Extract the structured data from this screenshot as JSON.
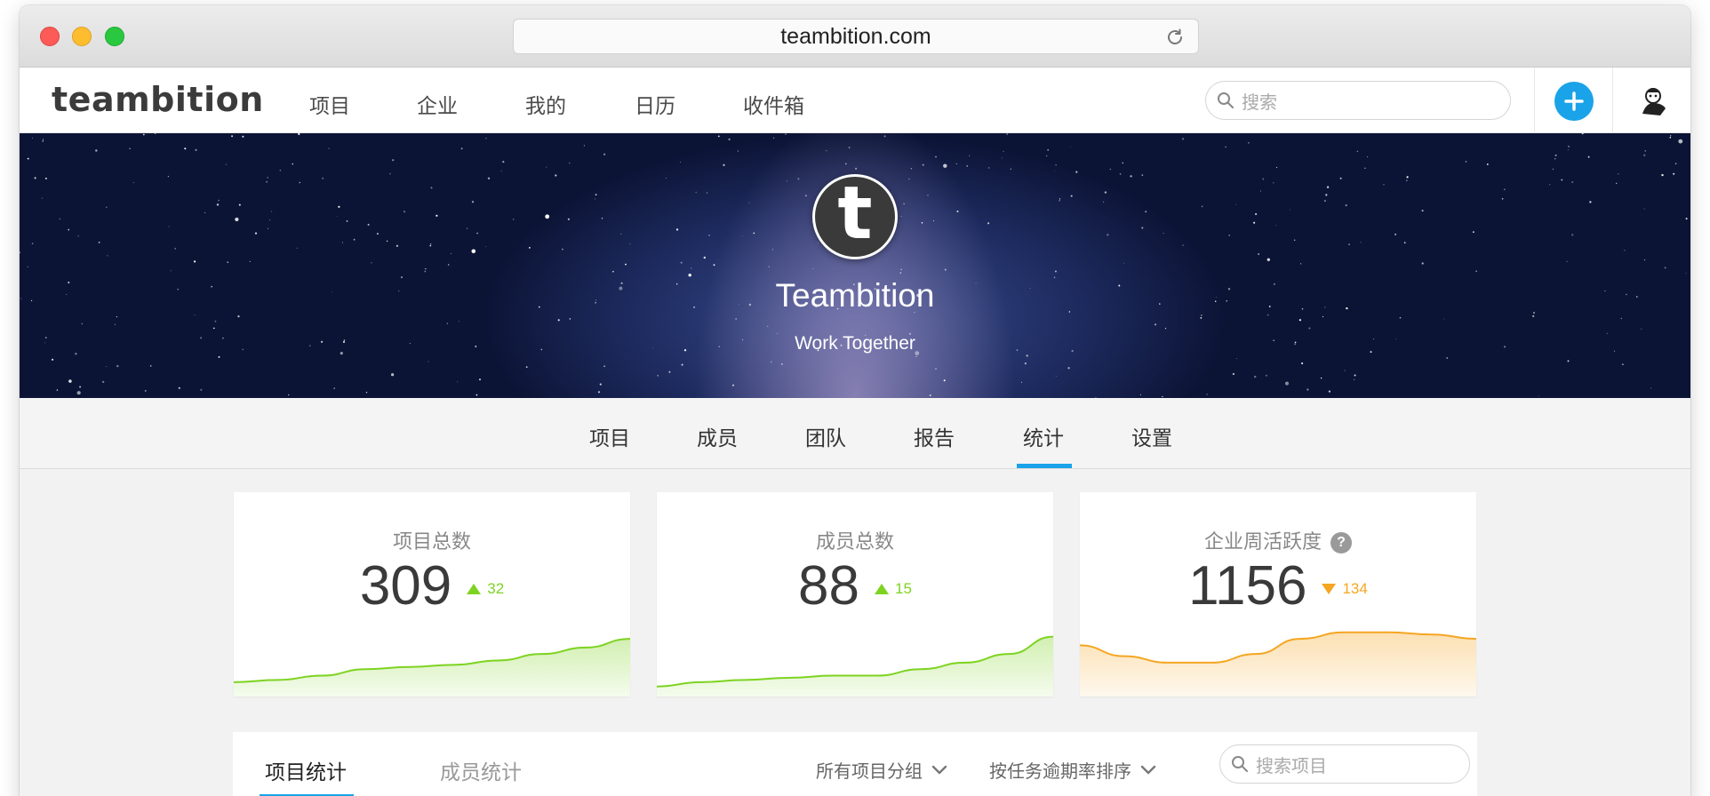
{
  "browser": {
    "url": "teambition.com"
  },
  "navbar": {
    "logo": "teambition",
    "items": [
      {
        "label": "项目"
      },
      {
        "label": "企业"
      },
      {
        "label": "我的"
      },
      {
        "label": "日历"
      },
      {
        "label": "收件箱"
      }
    ],
    "search_placeholder": "搜索"
  },
  "hero": {
    "logo_letter": "t",
    "title": "Teambition",
    "subtitle": "Work Together"
  },
  "subtabs": {
    "items": [
      {
        "label": "项目"
      },
      {
        "label": "成员"
      },
      {
        "label": "团队"
      },
      {
        "label": "报告"
      },
      {
        "label": "统计"
      },
      {
        "label": "设置"
      }
    ],
    "active": "统计"
  },
  "stats": [
    {
      "label": "项目总数",
      "value": "309",
      "delta": "32",
      "trend": "up",
      "color": "#7ed321",
      "series": [
        5,
        6,
        8,
        11,
        12,
        13,
        15,
        18,
        21,
        25
      ]
    },
    {
      "label": "成员总数",
      "value": "88",
      "delta": "15",
      "trend": "up",
      "color": "#7ed321",
      "series": [
        3,
        5,
        6,
        7,
        8,
        8,
        11,
        14,
        18,
        26
      ]
    },
    {
      "label": "企业周活跃度",
      "value": "1156",
      "delta": "134",
      "trend": "down",
      "color": "#f5a623",
      "help": "?",
      "series": [
        22,
        17,
        14,
        14,
        18,
        25,
        28,
        28,
        27,
        25
      ]
    }
  ],
  "panel": {
    "tabs": [
      {
        "label": "项目统计"
      },
      {
        "label": "成员统计"
      }
    ],
    "active_tab": "项目统计",
    "group_filter": "所有项目分组",
    "sort_filter": "按任务逾期率排序",
    "search_placeholder": "搜索项目"
  },
  "colors": {
    "accent": "#1aa3e8",
    "up": "#7ed321",
    "down": "#f5a623"
  }
}
